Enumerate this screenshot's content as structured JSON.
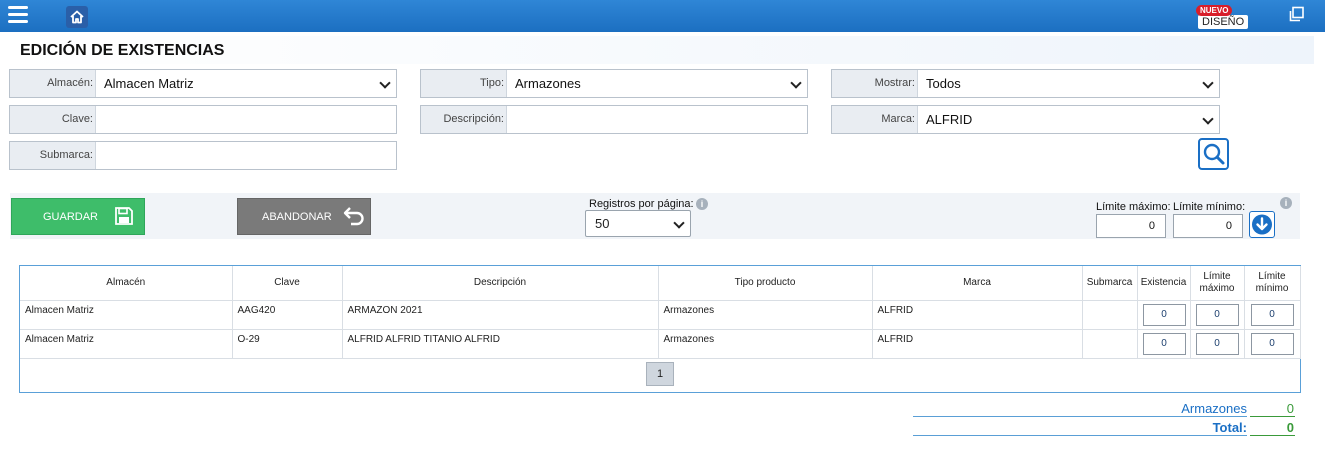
{
  "topbar": {
    "badge_new": "NUEVO",
    "badge_design": "DISEÑO"
  },
  "page": {
    "title": "EDICIÓN DE EXISTENCIAS"
  },
  "filters": {
    "almacen": {
      "label": "Almacén:",
      "value": "Almacen Matriz"
    },
    "tipo": {
      "label": "Tipo:",
      "value": "Armazones"
    },
    "mostrar": {
      "label": "Mostrar:",
      "value": "Todos"
    },
    "clave": {
      "label": "Clave:",
      "value": ""
    },
    "descripcion": {
      "label": "Descripción:",
      "value": ""
    },
    "marca": {
      "label": "Marca:",
      "value": "ALFRID"
    },
    "submarca": {
      "label": "Submarca:",
      "value": ""
    }
  },
  "actions": {
    "save_label": "GUARDAR",
    "abandon_label": "ABANDONAR",
    "records_per_page_label": "Registros por página:",
    "records_per_page_value": "50",
    "limit_max_label": "Límite máximo:",
    "limit_min_label": "Límite mínimo:",
    "limit_max_value": "0",
    "limit_min_value": "0",
    "info_glyph": "i"
  },
  "table": {
    "headers": [
      "Almacén",
      "Clave",
      "Descripción",
      "Tipo producto",
      "Marca",
      "Submarca",
      "Existencia",
      "Límite máximo",
      "Límite mínimo"
    ],
    "rows": [
      {
        "almacen": "Almacen Matriz",
        "clave": "AAG420",
        "descripcion": "ARMAZON 2021",
        "tipo": "Armazones",
        "marca": "ALFRID",
        "submarca": "",
        "existencia": "0",
        "lim_max": "0",
        "lim_min": "0"
      },
      {
        "almacen": "Almacen Matriz",
        "clave": "O-29",
        "descripcion": "ALFRID ALFRID TITANIO  ALFRID",
        "tipo": "Armazones",
        "marca": "ALFRID",
        "submarca": "",
        "existencia": "0",
        "lim_max": "0",
        "lim_min": "0"
      }
    ],
    "page": "1"
  },
  "totals": {
    "armazones_label": "Armazones",
    "armazones_value": "0",
    "total_label": "Total:",
    "total_value": "0"
  },
  "colors": {
    "topbar": "#1c6fc1",
    "save": "#3ebd6a",
    "abandon": "#7a7a7a",
    "accent": "#1a6fc5",
    "total_value": "#3a9a3a"
  },
  "icons": [
    "hamburger-icon",
    "home-icon",
    "restore-window-icon",
    "search-icon",
    "save-icon",
    "undo-icon",
    "info-icon",
    "arrow-down-circle-icon",
    "chevron-down-icon"
  ]
}
